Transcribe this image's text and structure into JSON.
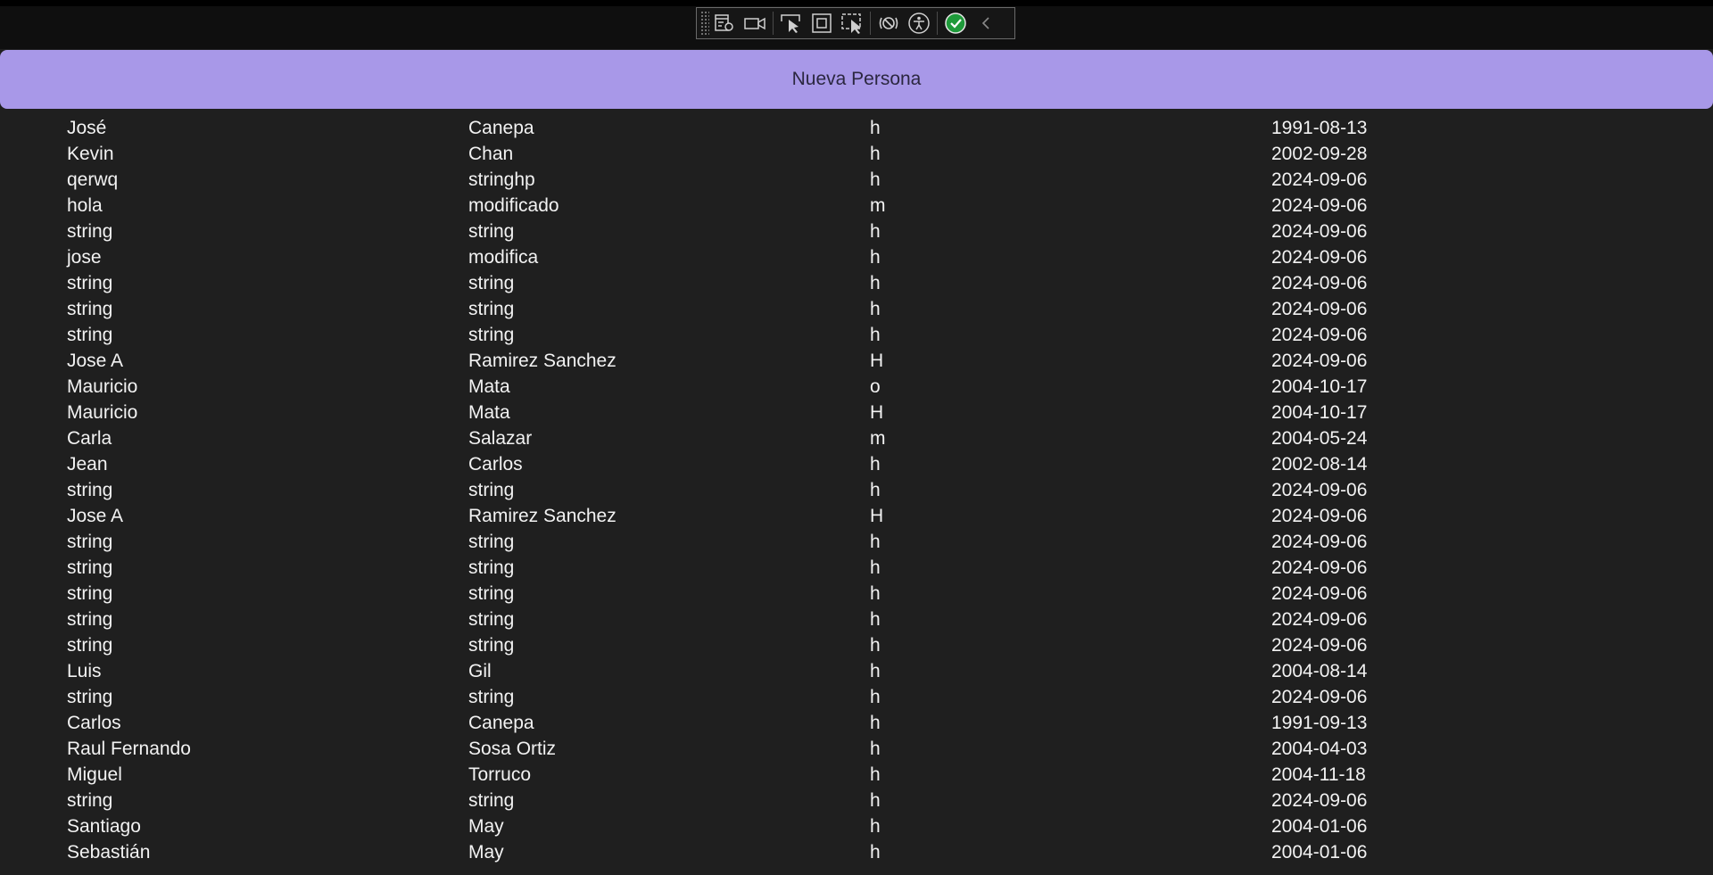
{
  "toolbar": {
    "tools": [
      {
        "icon": "live-visual-tree-icon"
      },
      {
        "icon": "record-icon"
      },
      {
        "icon": "select-element-icon"
      },
      {
        "icon": "display-layout-adorners-icon"
      },
      {
        "icon": "track-focused-element-icon"
      },
      {
        "icon": "binding-failures-icon"
      },
      {
        "icon": "accessibility-icon"
      },
      {
        "icon": "hot-reload-status-icon"
      },
      {
        "icon": "collapse-chevron-icon"
      }
    ],
    "accent": "#1e9a3a"
  },
  "banner": {
    "label": "Nueva Persona",
    "color": "#a898e8"
  },
  "people": [
    {
      "nombre": "José",
      "apellido": "Canepa",
      "sexo": "h",
      "fecha": "1991-08-13"
    },
    {
      "nombre": "Kevin",
      "apellido": "Chan",
      "sexo": "h",
      "fecha": "2002-09-28"
    },
    {
      "nombre": "qerwq",
      "apellido": "stringhp",
      "sexo": "h",
      "fecha": "2024-09-06"
    },
    {
      "nombre": "hola",
      "apellido": "modificado",
      "sexo": "m",
      "fecha": "2024-09-06"
    },
    {
      "nombre": "string",
      "apellido": "string",
      "sexo": "h",
      "fecha": "2024-09-06"
    },
    {
      "nombre": "jose",
      "apellido": "modifica",
      "sexo": "h",
      "fecha": "2024-09-06"
    },
    {
      "nombre": "string",
      "apellido": "string",
      "sexo": "h",
      "fecha": "2024-09-06"
    },
    {
      "nombre": "string",
      "apellido": "string",
      "sexo": "h",
      "fecha": "2024-09-06"
    },
    {
      "nombre": "string",
      "apellido": "string",
      "sexo": "h",
      "fecha": "2024-09-06"
    },
    {
      "nombre": "Jose A",
      "apellido": "Ramirez Sanchez",
      "sexo": "H",
      "fecha": "2024-09-06"
    },
    {
      "nombre": "Mauricio",
      "apellido": "Mata",
      "sexo": "o",
      "fecha": "2004-10-17"
    },
    {
      "nombre": "Mauricio",
      "apellido": "Mata",
      "sexo": "H",
      "fecha": "2004-10-17"
    },
    {
      "nombre": "Carla",
      "apellido": "Salazar",
      "sexo": "m",
      "fecha": "2004-05-24"
    },
    {
      "nombre": "Jean",
      "apellido": "Carlos",
      "sexo": "h",
      "fecha": "2002-08-14"
    },
    {
      "nombre": "string",
      "apellido": "string",
      "sexo": "h",
      "fecha": "2024-09-06"
    },
    {
      "nombre": "Jose A",
      "apellido": "Ramirez Sanchez",
      "sexo": "H",
      "fecha": "2024-09-06"
    },
    {
      "nombre": "string",
      "apellido": "string",
      "sexo": "h",
      "fecha": "2024-09-06"
    },
    {
      "nombre": "string",
      "apellido": "string",
      "sexo": "h",
      "fecha": "2024-09-06"
    },
    {
      "nombre": "string",
      "apellido": "string",
      "sexo": "h",
      "fecha": "2024-09-06"
    },
    {
      "nombre": "string",
      "apellido": "string",
      "sexo": "h",
      "fecha": "2024-09-06"
    },
    {
      "nombre": "string",
      "apellido": "string",
      "sexo": "h",
      "fecha": "2024-09-06"
    },
    {
      "nombre": "Luis",
      "apellido": "Gil",
      "sexo": "h",
      "fecha": "2004-08-14"
    },
    {
      "nombre": "string",
      "apellido": "string",
      "sexo": "h",
      "fecha": "2024-09-06"
    },
    {
      "nombre": "Carlos",
      "apellido": "Canepa",
      "sexo": "h",
      "fecha": "1991-09-13"
    },
    {
      "nombre": "Raul Fernando",
      "apellido": "Sosa Ortiz",
      "sexo": "h",
      "fecha": "2004-04-03"
    },
    {
      "nombre": "Miguel",
      "apellido": "Torruco",
      "sexo": "h",
      "fecha": "2004-11-18"
    },
    {
      "nombre": "string",
      "apellido": "string",
      "sexo": "h",
      "fecha": "2024-09-06"
    },
    {
      "nombre": "Santiago",
      "apellido": "May",
      "sexo": "h",
      "fecha": "2004-01-06"
    },
    {
      "nombre": "Sebastián",
      "apellido": "May",
      "sexo": "h",
      "fecha": "2004-01-06"
    }
  ]
}
